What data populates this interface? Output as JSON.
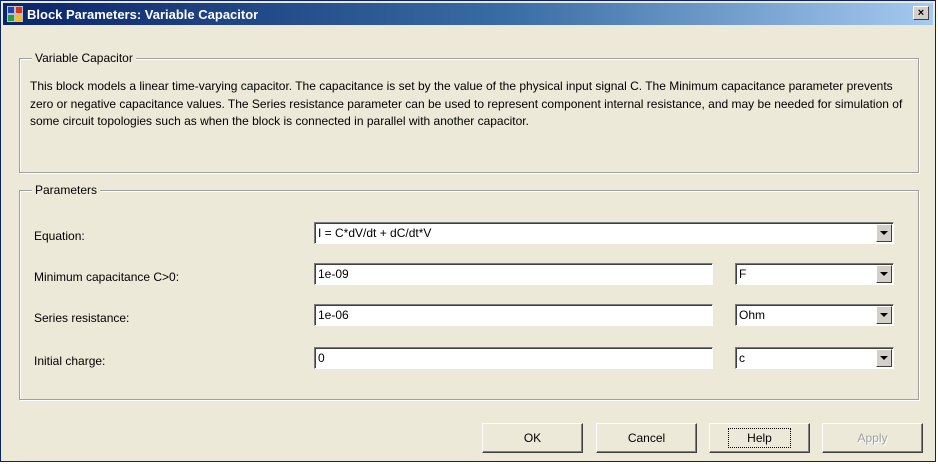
{
  "window": {
    "title": "Block Parameters: Variable Capacitor",
    "close_glyph": "×"
  },
  "description_group": {
    "legend": "Variable Capacitor",
    "text": "This block models a linear time-varying capacitor. The capacitance is set by the value of the physical input signal C. The Minimum capacitance parameter prevents zero or negative capacitance values. The Series resistance parameter can be used to represent component internal resistance, and may be needed for simulation of some circuit topologies such as when the block is connected in parallel with another capacitor."
  },
  "parameters_group": {
    "legend": "Parameters",
    "rows": [
      {
        "label": "Equation:",
        "value": "I = C*dV/dt + dC/dt*V"
      },
      {
        "label": "Minimum capacitance C>0:",
        "value": "1e-09",
        "unit": "F"
      },
      {
        "label": "Series resistance:",
        "value": "1e-06",
        "unit": "Ohm"
      },
      {
        "label": "Initial charge:",
        "value": "0",
        "unit": "c"
      }
    ]
  },
  "buttons": {
    "ok": "OK",
    "cancel": "Cancel",
    "help": "Help",
    "apply": "Apply"
  },
  "icons": {
    "app": "simulink-block-icon",
    "close": "close-icon",
    "dropdown": "chevron-down-icon"
  }
}
